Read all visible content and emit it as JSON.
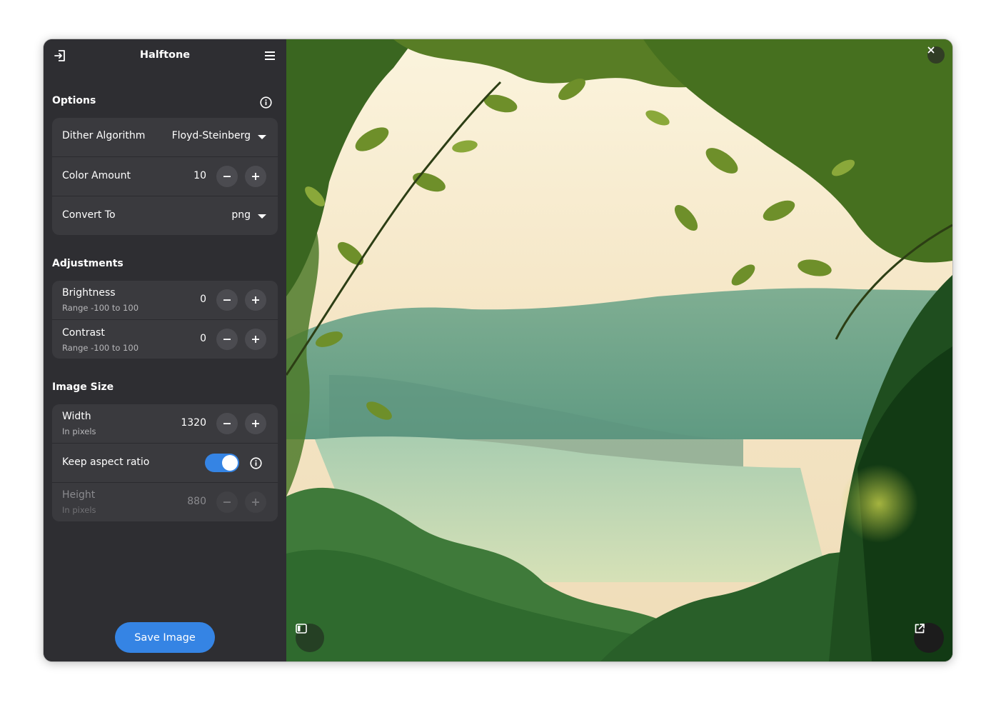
{
  "app": {
    "title": "Halftone"
  },
  "options": {
    "section_title": "Options",
    "dither_algorithm": {
      "label": "Dither Algorithm",
      "value": "Floyd-Steinberg"
    },
    "color_amount": {
      "label": "Color Amount",
      "value": "10"
    },
    "convert_to": {
      "label": "Convert To",
      "value": "png"
    }
  },
  "adjustments": {
    "section_title": "Adjustments",
    "brightness": {
      "label": "Brightness",
      "sub": "Range -100 to 100",
      "value": "0"
    },
    "contrast": {
      "label": "Contrast",
      "sub": "Range -100 to 100",
      "value": "0"
    }
  },
  "image_size": {
    "section_title": "Image Size",
    "width": {
      "label": "Width",
      "sub": "In pixels",
      "value": "1320"
    },
    "keep_aspect": {
      "label": "Keep aspect ratio",
      "enabled": true
    },
    "height": {
      "label": "Height",
      "sub": "In pixels",
      "value": "880"
    }
  },
  "save_button": "Save Image",
  "colors": {
    "accent": "#3584e4",
    "sidebar_bg": "#2e2e32",
    "card_bg": "#3a3a3e"
  },
  "icons": {
    "open": "open-file-icon",
    "menu": "hamburger-menu-icon",
    "info": "info-icon",
    "close": "close-icon",
    "sidebar_toggle": "sidebar-toggle-icon",
    "external": "open-external-icon"
  }
}
